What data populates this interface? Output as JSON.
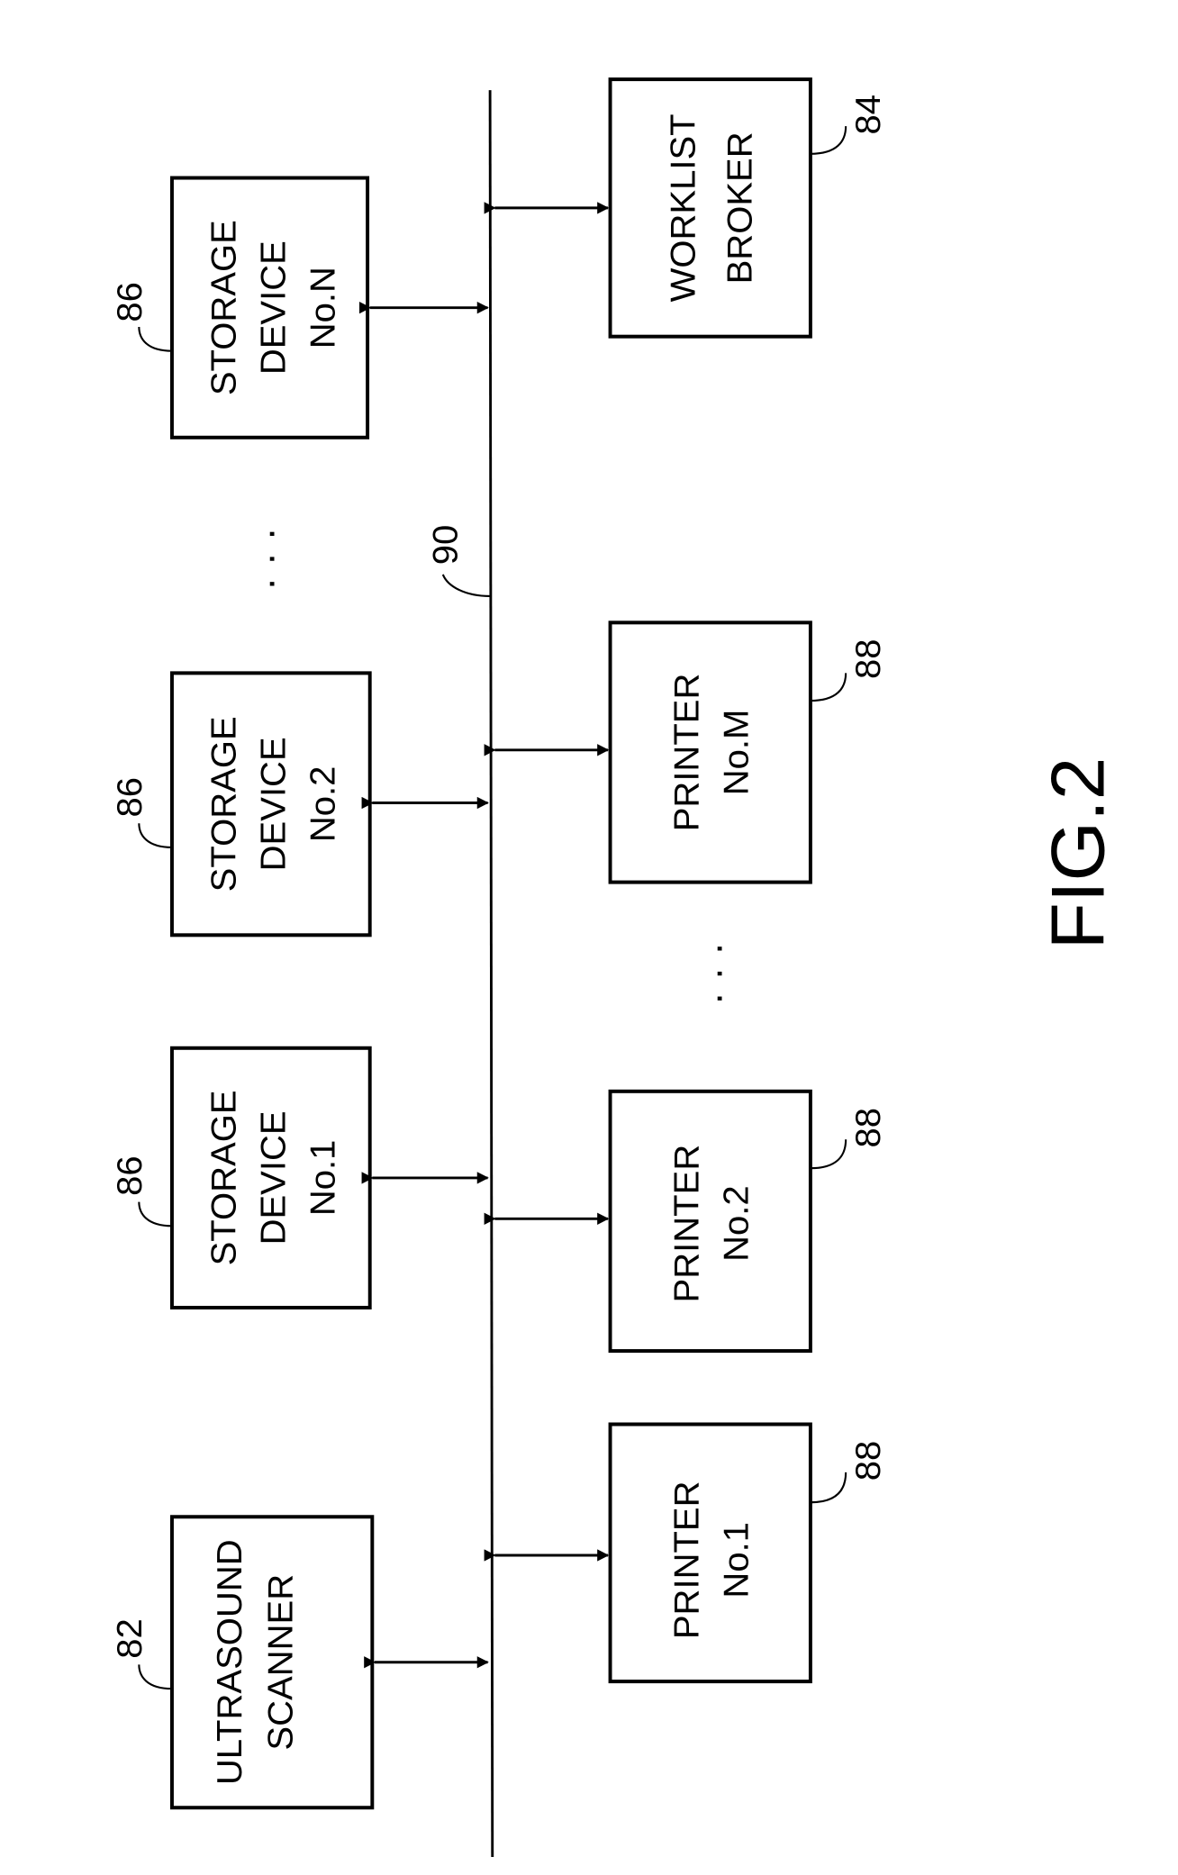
{
  "figure_label": "FIG.2",
  "bus": {
    "ref": "90"
  },
  "nodes": [
    {
      "id": "ultrasound-scanner",
      "lines": [
        "ULTRASOUND",
        "SCANNER"
      ],
      "ref": "82"
    },
    {
      "id": "storage-device-1",
      "lines": [
        "STORAGE",
        "DEVICE",
        "No.1"
      ],
      "ref": "86"
    },
    {
      "id": "storage-device-2",
      "lines": [
        "STORAGE",
        "DEVICE",
        "No.2"
      ],
      "ref": "86"
    },
    {
      "id": "storage-device-n",
      "lines": [
        "STORAGE",
        "DEVICE",
        "No.N"
      ],
      "ref": "86"
    },
    {
      "id": "printer-1",
      "lines": [
        "PRINTER",
        "No.1"
      ],
      "ref": "88"
    },
    {
      "id": "printer-2",
      "lines": [
        "PRINTER",
        "No.2"
      ],
      "ref": "88"
    },
    {
      "id": "printer-m",
      "lines": [
        "PRINTER",
        "No.M"
      ],
      "ref": "88"
    },
    {
      "id": "worklist-broker",
      "lines": [
        "WORKLIST",
        "BROKER"
      ],
      "ref": "84"
    }
  ],
  "ellipsis": "· · ·"
}
